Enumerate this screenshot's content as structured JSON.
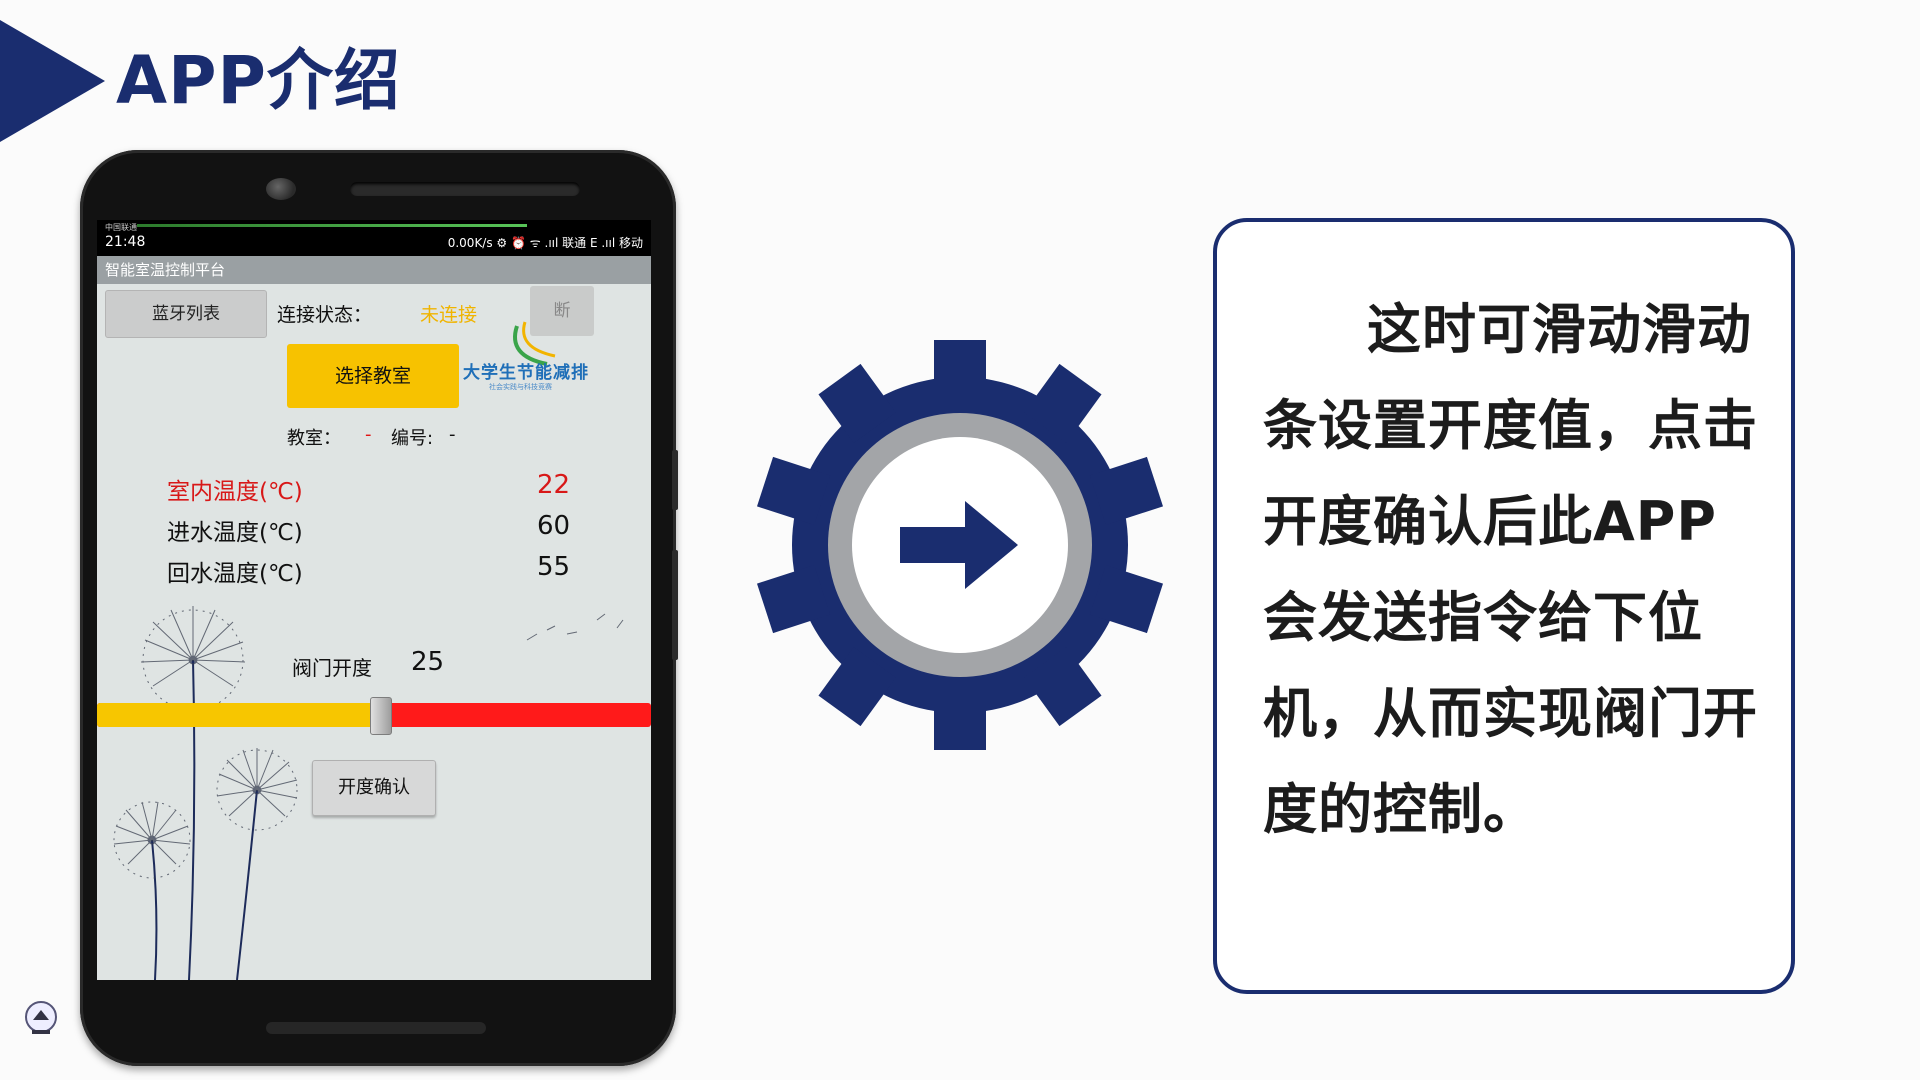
{
  "slide": {
    "title": "APP介绍",
    "description": "这时可滑动滑动条设置开度值，点击开度确认后此APP会发送指令给下位机，从而实现阀门开度的控制。"
  },
  "phone": {
    "status_bar": {
      "carrier_small": "中国联通",
      "time": "21:48",
      "right_text": "0.00K/s ⚙ ⏰ ᯤ .ııl 联通 E .ııl 移动"
    },
    "app_title": "智能室温控制平台",
    "bluetooth_list_button": "蓝牙列表",
    "connection_label": "连接状态：",
    "connection_value": "未连接",
    "disconnect_button": "断",
    "select_classroom_button": "选择教室",
    "logo_text": "大学生节能减排",
    "logo_subtext": "社会实践与科技竞赛",
    "classroom_label": "教室：",
    "classroom_value": "-",
    "number_label": "编号:",
    "number_value": "-",
    "temperatures": [
      {
        "label": "室内温度(℃)",
        "value": "22"
      },
      {
        "label": "进水温度(℃)",
        "value": "60"
      },
      {
        "label": "回水温度(℃)",
        "value": "55"
      }
    ],
    "valve": {
      "label": "阀门开度",
      "value": "25",
      "slider_fraction": 0.51
    },
    "confirm_button": "开度确认"
  },
  "colors": {
    "brand_navy": "#1a2d6f",
    "indoor_red": "#d81818",
    "slider_yellow": "#f7c600",
    "slider_red": "#ff1a1a",
    "button_yellow": "#f7c200"
  },
  "icons": {
    "title_marker": "triangle-arrow-icon",
    "gear": "gear-icon",
    "arrow": "arrow-right-icon",
    "footer": "university-logo-icon"
  }
}
